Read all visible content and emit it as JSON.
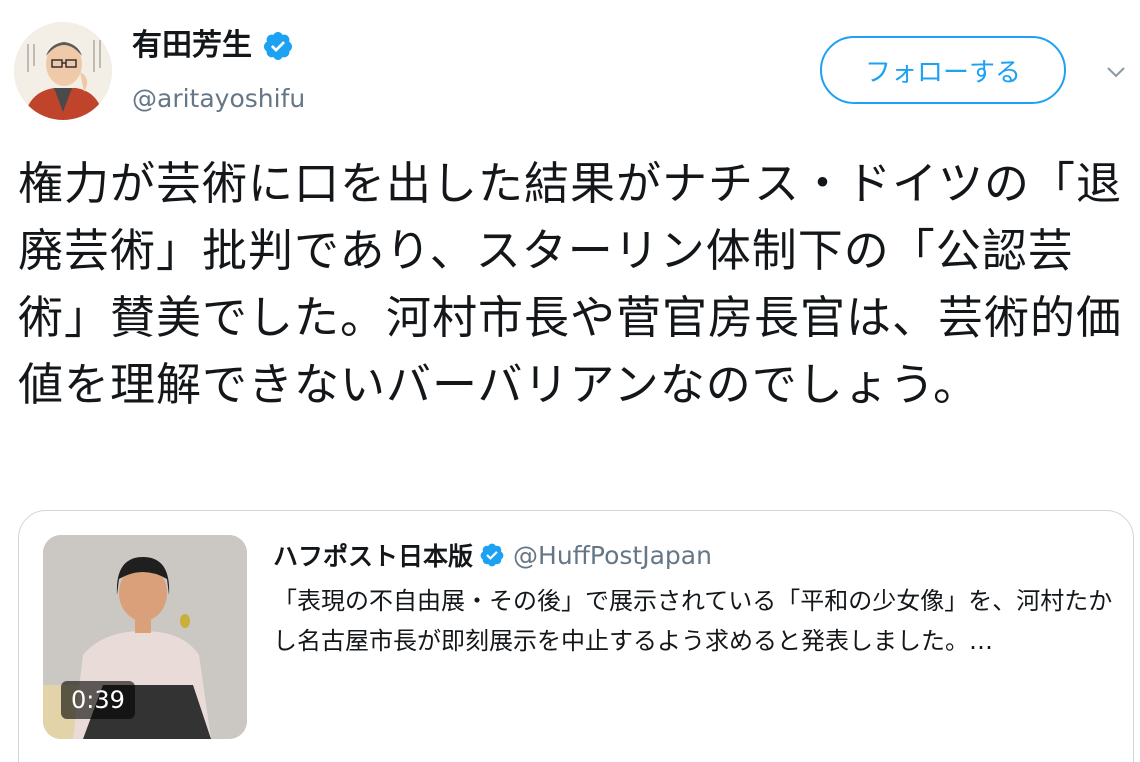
{
  "author": {
    "display_name": "有田芳生",
    "handle": "@aritayoshifu",
    "verified_icon": "verified-badge-icon"
  },
  "actions": {
    "follow_label": "フォローする",
    "menu_icon": "chevron-down-icon"
  },
  "tweet": {
    "text": "権力が芸術に口を出した結果がナチス・ドイツの「退廃芸術」批判であり、スターリン体制下の「公認芸術」賛美でした。河村市長や菅官房長官は、芸術的価値を理解できないバーバリアンなのでしょう。"
  },
  "quoted_tweet": {
    "display_name": "ハフポスト日本版",
    "handle": "@HuffPostJapan",
    "text": "「表現の不自由展・その後」で展示されている「平和の少女像」を、河村たかし名古屋市長が即刻展示を中止するよう求めると発表しました。…",
    "video_duration": "0:39"
  },
  "colors": {
    "accent": "#1da1f2",
    "secondary_text": "#657786",
    "border": "#ccd6dd"
  }
}
